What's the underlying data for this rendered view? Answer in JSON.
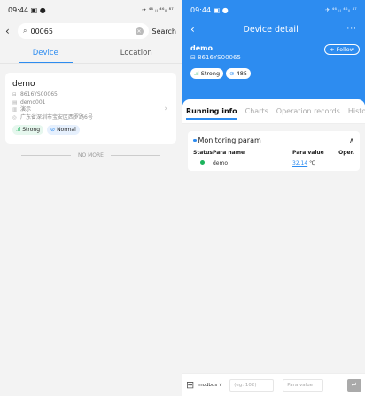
{
  "status_bar": {
    "time": "09:44",
    "left_icons": "▣ ●",
    "right_icons": "✈ ⁴⁶ ᵢₗ ⁴⁶ᵢₗ ⁸⁷"
  },
  "search": {
    "query": "00065",
    "button": "Search"
  },
  "list_tabs": [
    {
      "label": "Device"
    },
    {
      "label": "Location"
    }
  ],
  "device_card": {
    "name": "demo",
    "sn": "8616YS00065",
    "model": "demo001",
    "group": "演示",
    "address": "广东省深圳市宝安区西罗路6号",
    "signal": "Strong",
    "state": "Normal"
  },
  "no_more": "NO MORE",
  "detail": {
    "title": "Device detail",
    "more": "···",
    "name": "demo",
    "sn": "8616YS00065",
    "follow": "+ Follow",
    "signal": "Strong",
    "link_value": "485",
    "tabs": [
      {
        "label": "Running info"
      },
      {
        "label": "Charts"
      },
      {
        "label": "Operation records"
      },
      {
        "label": "History fau"
      }
    ],
    "monitoring": {
      "title": "Monitoring param",
      "headers": [
        "Status",
        "Para name",
        "Para value",
        "Oper."
      ],
      "rows": [
        {
          "name": "demo",
          "value": "32.14",
          "unit": "℃"
        }
      ]
    },
    "bottom": {
      "protocol": "modbus ∨",
      "reg_placeholder": "(eg: 102)",
      "value_placeholder": "Para value"
    }
  },
  "colors": {
    "accent": "#2d8cf0",
    "signal": "#1cb35c"
  }
}
